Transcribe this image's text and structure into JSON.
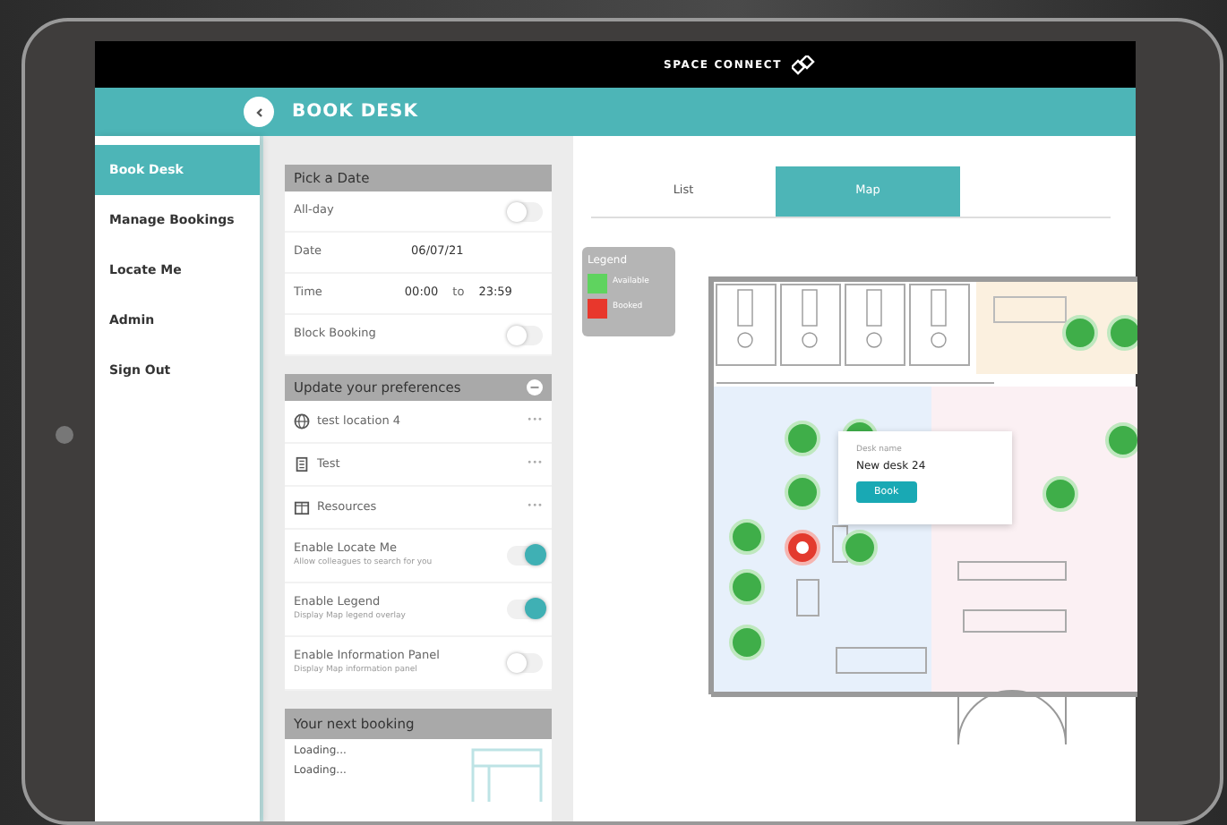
{
  "header": {
    "brand": "SPACE CONNECT",
    "page_title": "BOOK DESK"
  },
  "sidebar": {
    "items": [
      {
        "label": "Book Desk",
        "selected": true
      },
      {
        "label": "Manage Bookings",
        "selected": false
      },
      {
        "label": "Locate Me",
        "selected": false
      },
      {
        "label": "Admin",
        "selected": false
      },
      {
        "label": "Sign Out",
        "selected": false
      }
    ]
  },
  "pick_date": {
    "title": "Pick a Date",
    "all_day": {
      "label": "All-day",
      "on": false
    },
    "date": {
      "label": "Date",
      "value": "06/07/21"
    },
    "time": {
      "label": "Time",
      "from": "00:00",
      "separator": "to",
      "to": "23:59"
    },
    "block_booking": {
      "label": "Block Booking",
      "on": false
    }
  },
  "preferences": {
    "title": "Update your preferences",
    "items": [
      {
        "kind": "select",
        "label": "test location 4",
        "more": "•••"
      },
      {
        "kind": "select",
        "label": "Test",
        "more": "•••"
      },
      {
        "kind": "select",
        "label": "Resources",
        "more": "•••"
      },
      {
        "kind": "toggle",
        "label": "Enable Locate Me",
        "hint": "Allow colleagues to search for you",
        "on": true
      },
      {
        "kind": "toggle",
        "label": "Enable Legend",
        "hint": "Display Map legend overlay",
        "on": true
      },
      {
        "kind": "toggle",
        "label": "Enable Information Panel",
        "hint": "Display Map information panel",
        "on": false
      }
    ]
  },
  "next_booking": {
    "title": "Your next booking",
    "lines": [
      "Loading...",
      "Loading..."
    ]
  },
  "view_tabs": [
    {
      "label": "List",
      "selected": false
    },
    {
      "label": "Map",
      "selected": true
    }
  ],
  "legend": {
    "title": "Legend",
    "items": [
      {
        "label": "Available",
        "color": "#5fd35f"
      },
      {
        "label": "Booked",
        "color": "#e8372c"
      }
    ]
  },
  "desk_popup": {
    "caption": "Desk name",
    "name": "New desk 24",
    "button": "Book"
  }
}
